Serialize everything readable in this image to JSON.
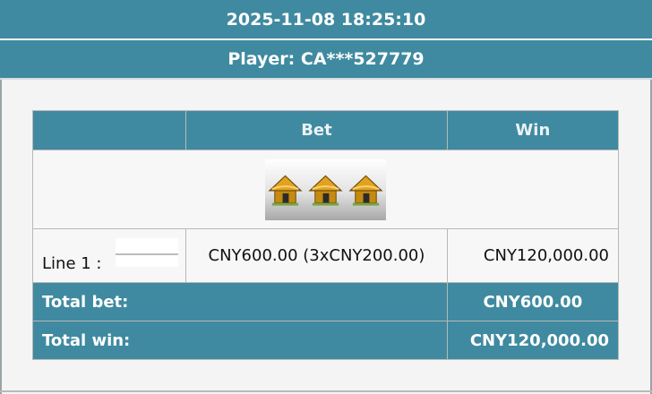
{
  "header": {
    "datetime": "2025-11-08 18:25:10",
    "player": "Player: CA***527779"
  },
  "table": {
    "columns": [
      "",
      "Bet",
      "Win"
    ],
    "symbols": [
      "hut-icon",
      "hut-icon",
      "hut-icon"
    ],
    "line": {
      "label": "Line 1 :",
      "bet": "CNY600.00 (3xCNY200.00)",
      "win": "CNY120,000.00"
    },
    "total_bet": {
      "label": "Total bet:",
      "value": "CNY600.00"
    },
    "total_win": {
      "label": "Total win:",
      "value": "CNY120,000.00"
    }
  },
  "colors": {
    "header_bg": "#3f8aa0",
    "header_text": "#ffffff",
    "hut_roof": "#e2a21e",
    "hut_body": "#c58a10"
  }
}
